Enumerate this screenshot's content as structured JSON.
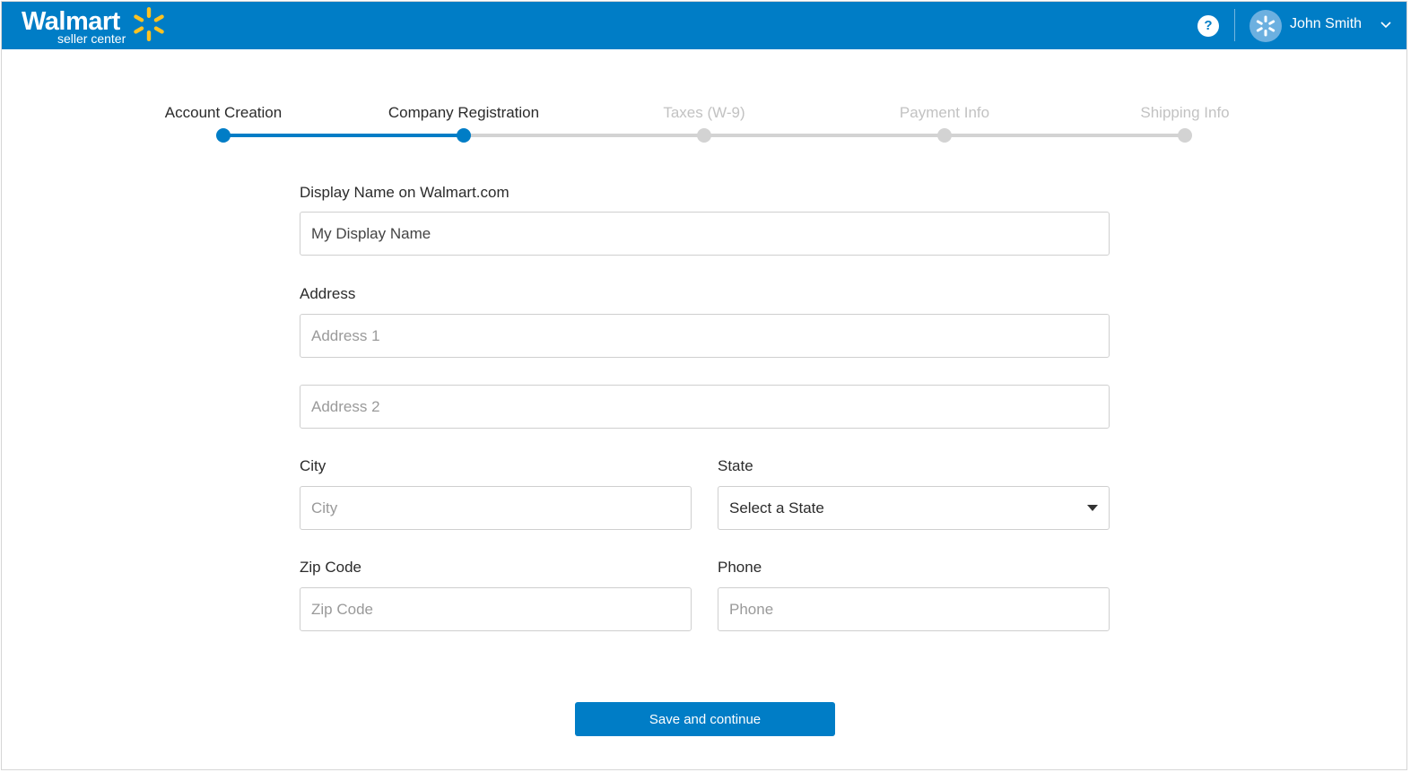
{
  "header": {
    "brand": "Walmart",
    "brand_sub": "seller center",
    "help_glyph": "?",
    "user_name": "John Smith",
    "bg_color": "#007dc6"
  },
  "steps": [
    {
      "label": "Account Creation",
      "status": "complete"
    },
    {
      "label": "Company Registration",
      "status": "current"
    },
    {
      "label": "Taxes (W-9)",
      "status": "upcoming"
    },
    {
      "label": "Payment Info",
      "status": "upcoming"
    },
    {
      "label": "Shipping Info",
      "status": "upcoming"
    }
  ],
  "form": {
    "display_name": {
      "label": "Display Name on Walmart.com",
      "value": "My Display Name"
    },
    "address": {
      "label": "Address",
      "line1_placeholder": "Address 1",
      "line2_placeholder": "Address 2"
    },
    "city": {
      "label": "City",
      "placeholder": "City"
    },
    "state": {
      "label": "State",
      "selected": "Select a State"
    },
    "zip": {
      "label": "Zip Code",
      "placeholder": "Zip Code"
    },
    "phone": {
      "label": "Phone",
      "placeholder": "Phone"
    }
  },
  "actions": {
    "save_label": "Save and continue"
  },
  "colors": {
    "accent": "#007dc6",
    "inactive": "#d3d3d3",
    "spark": "#ffc220"
  }
}
